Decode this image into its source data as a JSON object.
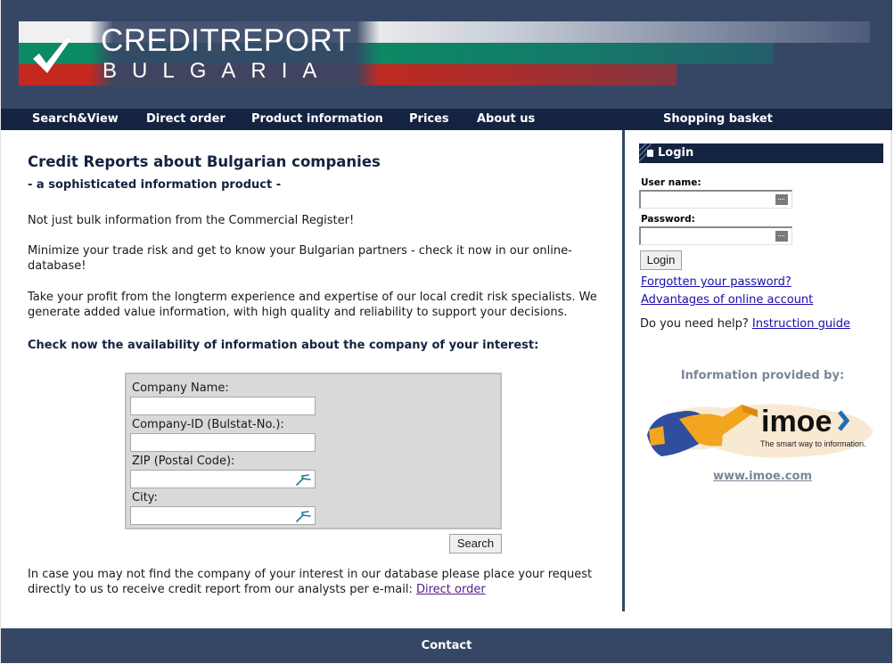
{
  "brand": {
    "title": "CREDITREPORT",
    "subtitle": "BULGARIA",
    "colors": {
      "header_bg": "#364766",
      "nav_bg": "#142341",
      "flag_white": "#f0f0f0",
      "flag_green": "#0b8a64",
      "flag_red": "#c5281e"
    }
  },
  "nav": {
    "items": [
      {
        "label": "Search&View"
      },
      {
        "label": "Direct order"
      },
      {
        "label": "Product information"
      },
      {
        "label": "Prices"
      },
      {
        "label": "About us"
      },
      {
        "label": "Shopping basket"
      }
    ]
  },
  "main": {
    "title": "Credit Reports about Bulgarian companies",
    "subtitle": "- a sophisticated information product -",
    "paragraphs": [
      "Not just bulk information from the Commercial Register!",
      "Minimize your trade risk and get to know your Bulgarian partners - check it now in our online-database!",
      "Take your profit from the longterm experience and expertise of our local credit risk specialists. We generate added value information, with high quality and reliability to support your decisions."
    ],
    "check_heading": "Check now the availability of information about the company of your interest:",
    "form": {
      "fields": [
        {
          "label": "Company Name:",
          "value": "",
          "icon": null
        },
        {
          "label": "Company-ID (Bulstat-No.):",
          "value": "",
          "icon": null
        },
        {
          "label": "ZIP (Postal Code):",
          "value": "",
          "icon": "autocomplete-icon"
        },
        {
          "label": "City:",
          "value": "",
          "icon": "autocomplete-icon"
        }
      ],
      "search_button": "Search"
    },
    "footer_note": "In case you may not find the company of your interest in our database please place your request directly to us to receive credit report from our analysts per e-mail:",
    "footer_link": "Direct order"
  },
  "sidebar": {
    "login": {
      "title": "Login",
      "username_label": "User name:",
      "username_value": "",
      "password_label": "Password:",
      "password_value": "",
      "button": "Login",
      "forgot_link": "Forgotten your password?",
      "advantages_link": "Advantages of online account",
      "help_text": "Do you need help?",
      "help_link": "Instruction guide"
    },
    "provider": {
      "heading": "Information provided by:",
      "logo_text": "imoe",
      "logo_tagline": "The smart way to information.",
      "link": "www.imoe.com"
    }
  },
  "footer": {
    "contact": "Contact"
  }
}
